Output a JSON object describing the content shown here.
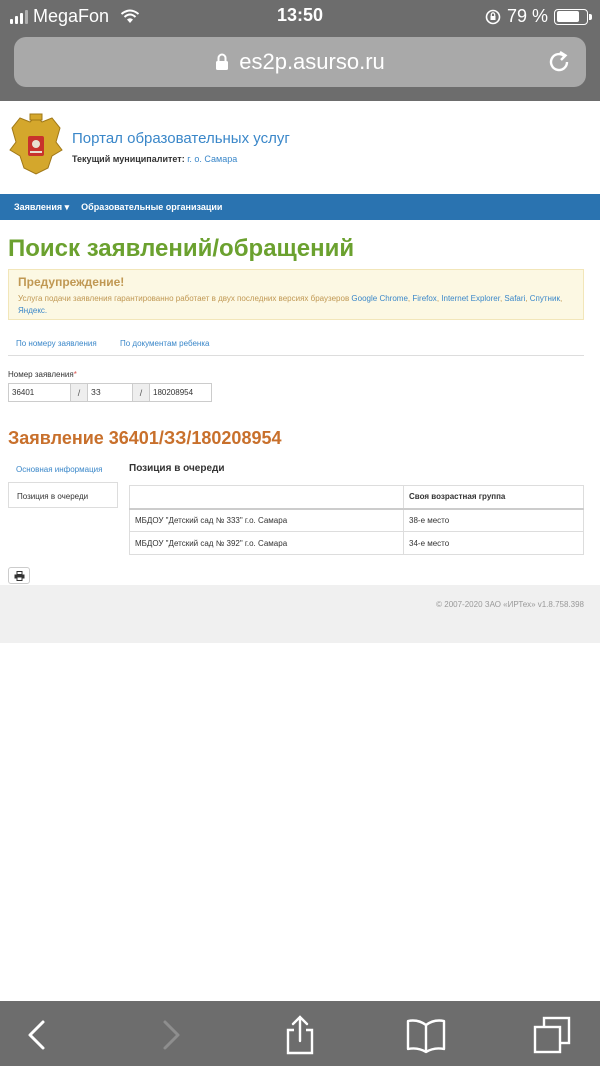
{
  "status": {
    "carrier": "MegaFon",
    "time": "13:50",
    "battery": "79 %",
    "battery_level": 0.79
  },
  "browser": {
    "url": "es2p.asurso.ru"
  },
  "header": {
    "portal_title": "Портал образовательных услуг",
    "muni_label": "Текущий муниципалитет:",
    "muni_value": "г. о. Самара"
  },
  "nav": {
    "applications": "Заявления ▾",
    "organizations": "Образовательные организации"
  },
  "page": {
    "title": "Поиск заявлений/обращений"
  },
  "alert": {
    "heading": "Предупреждение!",
    "text_prefix": "Услуга подачи заявления гарантированно работает в двух последних версиях браузеров ",
    "browsers": [
      "Google Chrome",
      "Firefox",
      "Internet Explorer",
      "Safari",
      "Спутник",
      "Яндекс."
    ]
  },
  "search_tabs": [
    "По номеру заявления",
    "По документам ребенка"
  ],
  "form": {
    "label": "Номер заявления",
    "required_mark": "*",
    "part1": "36401",
    "part2": "ЗЗ",
    "part3": "180208954",
    "sep": "/"
  },
  "application": {
    "title": "Заявление 36401/ЗЗ/180208954",
    "side_items": [
      "Основная информация",
      "Позиция в очереди"
    ],
    "queue_title": "Позиция в очереди",
    "table": {
      "columns": [
        "",
        "Своя возрастная группа"
      ],
      "rows": [
        [
          "МБДОУ \"Детский сад № 333\" г.о. Самара",
          "38-е место"
        ],
        [
          "МБДОУ \"Детский сад № 392\" г.о. Самара",
          "34-е место"
        ]
      ]
    }
  },
  "footer": {
    "copyright": "© 2007-2020 ЗАО «ИРТех» v1.8.758.398"
  }
}
